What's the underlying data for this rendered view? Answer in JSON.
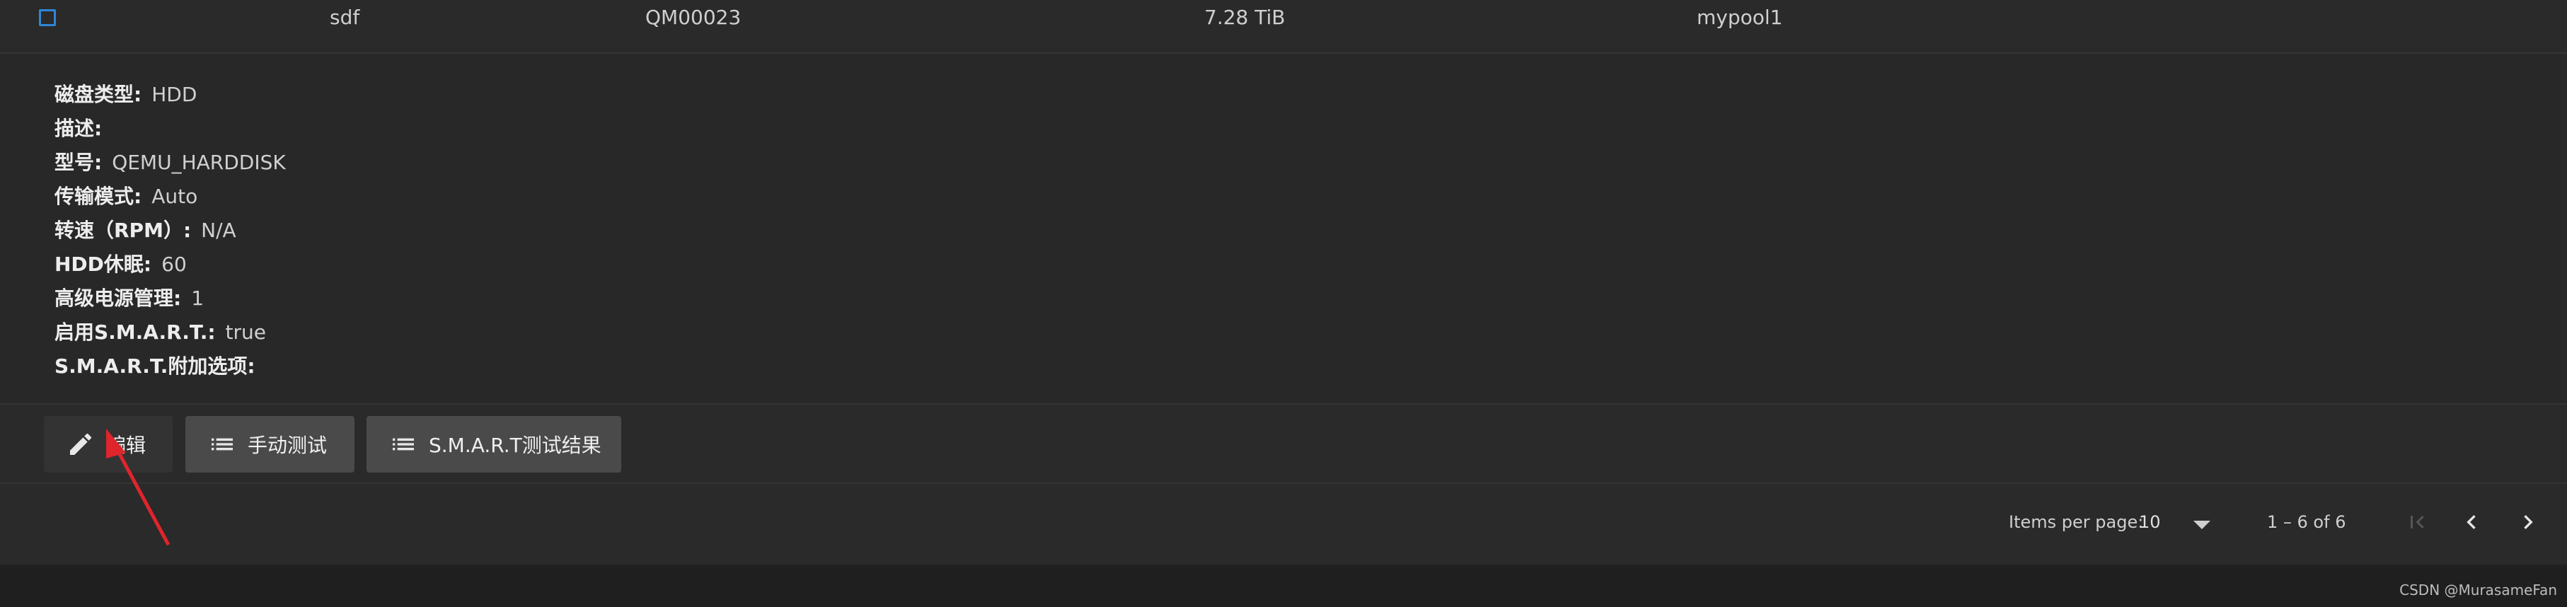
{
  "disk_row": {
    "name": "sdf",
    "serial": "QM00023",
    "size": "7.28 TiB",
    "pool": "mypool1"
  },
  "details": [
    {
      "key": "磁盘类型:",
      "value": "HDD"
    },
    {
      "key": "描述:",
      "value": ""
    },
    {
      "key": "型号:",
      "value": "QEMU_HARDDISK"
    },
    {
      "key": "传输模式:",
      "value": "Auto"
    },
    {
      "key": "转速（RPM）:",
      "value": "N/A"
    },
    {
      "key": "HDD休眠:",
      "value": "60"
    },
    {
      "key": "高级电源管理:",
      "value": "1"
    },
    {
      "key": "启用S.M.A.R.T.:",
      "value": "true"
    },
    {
      "key": "S.M.A.R.T.附加选项:",
      "value": ""
    }
  ],
  "actions": {
    "edit_label": "编辑",
    "manual_test_label": "手动测试",
    "smart_results_label": "S.M.A.R.T测试结果"
  },
  "paginator": {
    "items_per_page_label": "Items per page:",
    "items_per_page_value": "10",
    "range_label": "1 – 6 of 6"
  },
  "footer": {
    "watermark": "CSDN @MurasameFan"
  },
  "colors": {
    "checkbox_accent": "#2f86d6",
    "annotation_arrow": "#e0242c"
  },
  "icons": [
    "checkbox-icon",
    "edit-pencil-icon",
    "list-icon",
    "first-page-icon",
    "previous-page-icon",
    "next-page-icon",
    "dropdown-caret-icon"
  ]
}
